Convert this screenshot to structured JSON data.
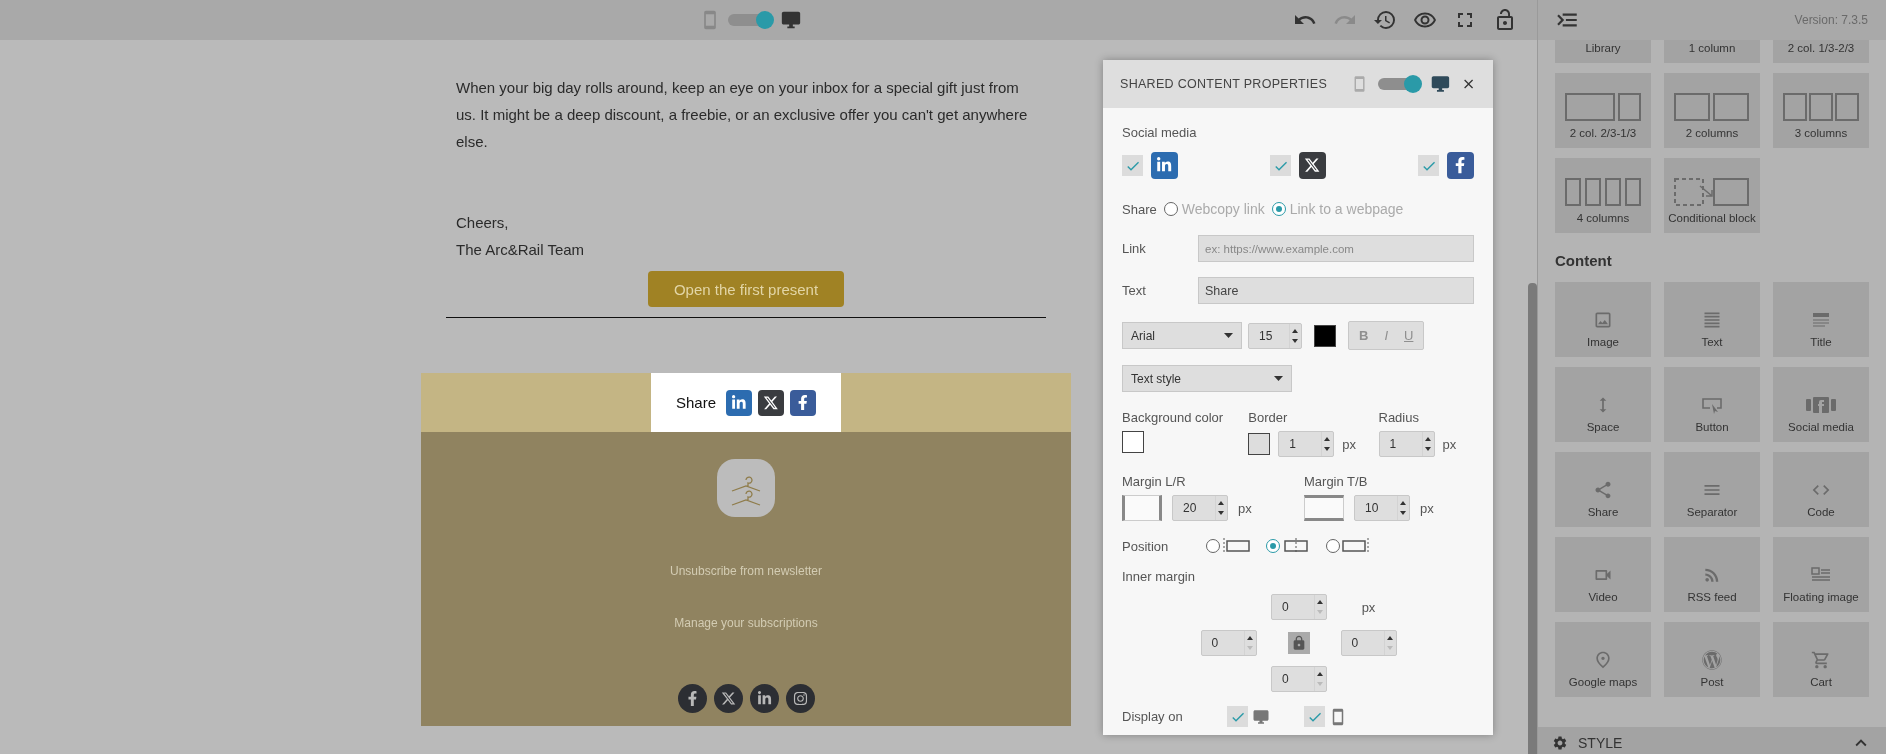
{
  "toolbar": {
    "desktop_view": true,
    "tools": [
      {
        "kind": "undo",
        "disabled": false
      },
      {
        "kind": "redo",
        "disabled": true
      },
      {
        "kind": "history",
        "disabled": false
      },
      {
        "kind": "preview",
        "disabled": false
      },
      {
        "kind": "fullscreen",
        "disabled": false
      },
      {
        "kind": "lock",
        "disabled": false
      }
    ],
    "version": "Version: 7.3.5"
  },
  "email": {
    "paragraph": "When your big day rolls around, keep an eye on your inbox for a special gift just from us. It might be a deep discount, a freebie, or an exclusive offer you can't get anywhere else.",
    "closing": [
      "Cheers,",
      "The Arc&Rail Team"
    ],
    "button": "Open the first present",
    "share": {
      "label": "Share",
      "networks": [
        {
          "kind": "linkedin"
        },
        {
          "kind": "x"
        },
        {
          "kind": "facebook"
        }
      ]
    },
    "footer": {
      "links": [
        "Unsubscribe from newsletter",
        "Manage your subscriptions"
      ],
      "social": [
        {
          "kind": "facebook"
        },
        {
          "kind": "x"
        },
        {
          "kind": "linkedin"
        },
        {
          "kind": "instagram"
        }
      ]
    }
  },
  "panel": {
    "layouts": [
      {
        "kind": "library",
        "label": "Library"
      },
      {
        "kind": "one",
        "label": "1 column"
      },
      {
        "kind": "third",
        "label": "2 col. 1/3-2/3"
      },
      {
        "kind": "twothird",
        "label": "2 col. 2/3-1/3"
      },
      {
        "kind": "two",
        "label": "2 columns"
      },
      {
        "kind": "three",
        "label": "3 columns"
      },
      {
        "kind": "four",
        "label": "4 columns"
      },
      {
        "kind": "conditional",
        "label": "Conditional block"
      }
    ],
    "content_heading": "Content",
    "blocks": [
      {
        "kind": "image",
        "label": "Image"
      },
      {
        "kind": "text",
        "label": "Text"
      },
      {
        "kind": "title",
        "label": "Title"
      },
      {
        "kind": "space",
        "label": "Space"
      },
      {
        "kind": "button",
        "label": "Button"
      },
      {
        "kind": "social",
        "label": "Social media"
      },
      {
        "kind": "share",
        "label": "Share"
      },
      {
        "kind": "separator",
        "label": "Separator"
      },
      {
        "kind": "code",
        "label": "Code"
      },
      {
        "kind": "video",
        "label": "Video"
      },
      {
        "kind": "rss",
        "label": "RSS feed"
      },
      {
        "kind": "floating",
        "label": "Floating image"
      },
      {
        "kind": "maps",
        "label": "Google maps"
      },
      {
        "kind": "post",
        "label": "Post"
      },
      {
        "kind": "cart",
        "label": "Cart"
      }
    ],
    "style_section": {
      "label": "STYLE",
      "expanded": false
    }
  },
  "dialog": {
    "title": "SHARED CONTENT PROPERTIES",
    "desktop_view": true,
    "social_label": "Social media",
    "networks": [
      {
        "kind": "linkedin",
        "checked": true
      },
      {
        "kind": "x",
        "checked": true
      },
      {
        "kind": "facebook",
        "checked": true
      }
    ],
    "share_label": "Share",
    "share_options": [
      {
        "label": "Webcopy link",
        "selected": false
      },
      {
        "label": "Link to a webpage",
        "selected": true
      }
    ],
    "link": {
      "label": "Link",
      "placeholder": "ex: https://www.example.com"
    },
    "text": {
      "label": "Text",
      "value": "Share"
    },
    "font": {
      "family": "Arial",
      "size": "15",
      "color": "#000000"
    },
    "format": [
      {
        "kind": "bold",
        "label": "B",
        "disabled": true
      },
      {
        "kind": "italic",
        "label": "I",
        "disabled": true
      },
      {
        "kind": "underline",
        "label": "U",
        "disabled": true
      }
    ],
    "text_style": "Text style",
    "background": {
      "label": "Background color",
      "color": "#ffffff"
    },
    "border": {
      "label": "Border",
      "color": "#dddddd",
      "value": "1",
      "unit": "px"
    },
    "radius": {
      "label": "Radius",
      "value": "1",
      "unit": "px"
    },
    "margin_lr": {
      "label": "Margin L/R",
      "value": "20",
      "unit": "px"
    },
    "margin_tb": {
      "label": "Margin T/B",
      "value": "10",
      "unit": "px"
    },
    "position": {
      "label": "Position",
      "options": [
        {
          "kind": "left",
          "selected": false
        },
        {
          "kind": "center",
          "selected": true
        },
        {
          "kind": "right",
          "selected": false
        }
      ]
    },
    "inner_margin": {
      "label": "Inner margin",
      "fields": [
        "0",
        "0",
        "0",
        "0"
      ],
      "unit": "px",
      "locked": true
    },
    "display_on": {
      "label": "Display on",
      "devices": [
        {
          "kind": "desktop",
          "checked": true
        },
        {
          "kind": "mobile",
          "checked": true
        }
      ]
    }
  }
}
